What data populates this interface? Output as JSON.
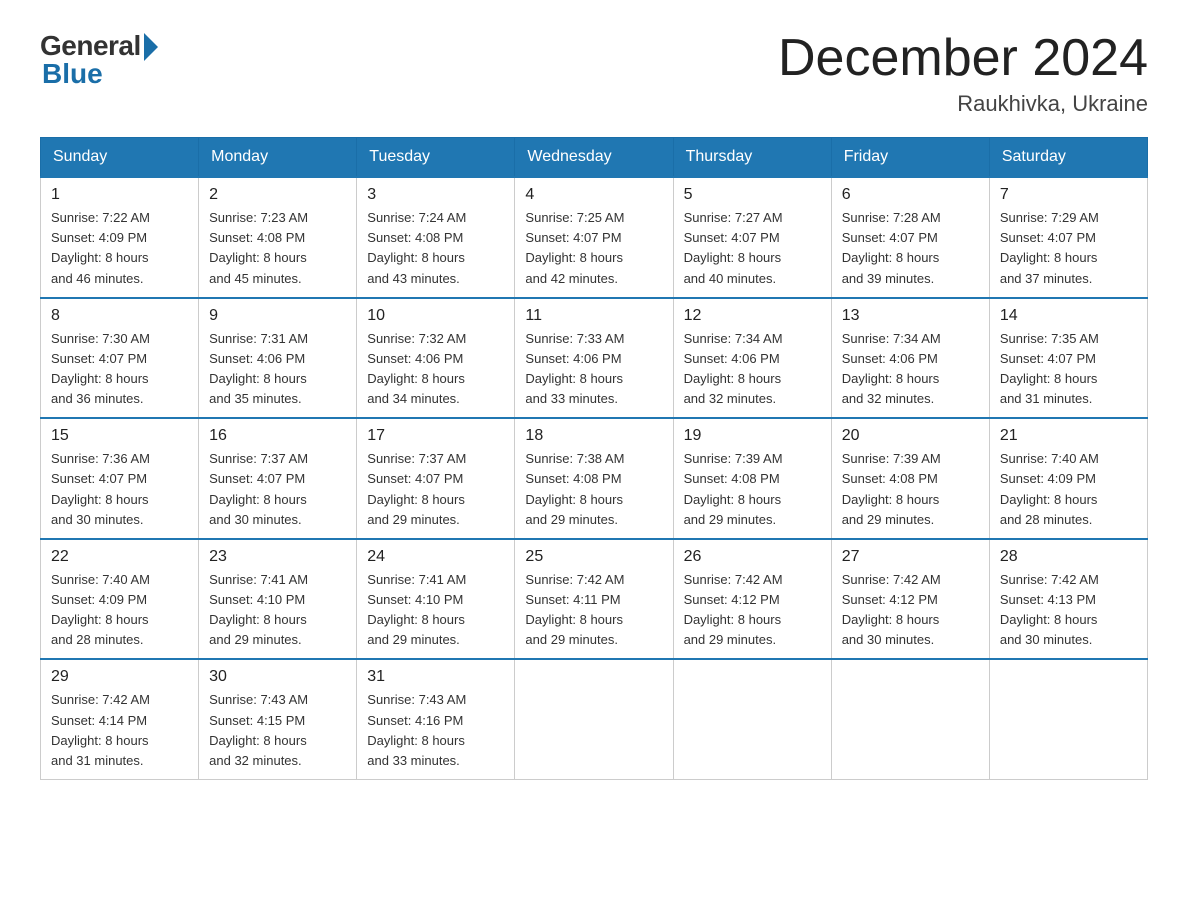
{
  "logo": {
    "general": "General",
    "blue": "Blue"
  },
  "header": {
    "month": "December 2024",
    "location": "Raukhivka, Ukraine"
  },
  "weekdays": [
    "Sunday",
    "Monday",
    "Tuesday",
    "Wednesday",
    "Thursday",
    "Friday",
    "Saturday"
  ],
  "weeks": [
    [
      {
        "day": "1",
        "sunrise": "7:22 AM",
        "sunset": "4:09 PM",
        "daylight": "8 hours and 46 minutes."
      },
      {
        "day": "2",
        "sunrise": "7:23 AM",
        "sunset": "4:08 PM",
        "daylight": "8 hours and 45 minutes."
      },
      {
        "day": "3",
        "sunrise": "7:24 AM",
        "sunset": "4:08 PM",
        "daylight": "8 hours and 43 minutes."
      },
      {
        "day": "4",
        "sunrise": "7:25 AM",
        "sunset": "4:07 PM",
        "daylight": "8 hours and 42 minutes."
      },
      {
        "day": "5",
        "sunrise": "7:27 AM",
        "sunset": "4:07 PM",
        "daylight": "8 hours and 40 minutes."
      },
      {
        "day": "6",
        "sunrise": "7:28 AM",
        "sunset": "4:07 PM",
        "daylight": "8 hours and 39 minutes."
      },
      {
        "day": "7",
        "sunrise": "7:29 AM",
        "sunset": "4:07 PM",
        "daylight": "8 hours and 37 minutes."
      }
    ],
    [
      {
        "day": "8",
        "sunrise": "7:30 AM",
        "sunset": "4:07 PM",
        "daylight": "8 hours and 36 minutes."
      },
      {
        "day": "9",
        "sunrise": "7:31 AM",
        "sunset": "4:06 PM",
        "daylight": "8 hours and 35 minutes."
      },
      {
        "day": "10",
        "sunrise": "7:32 AM",
        "sunset": "4:06 PM",
        "daylight": "8 hours and 34 minutes."
      },
      {
        "day": "11",
        "sunrise": "7:33 AM",
        "sunset": "4:06 PM",
        "daylight": "8 hours and 33 minutes."
      },
      {
        "day": "12",
        "sunrise": "7:34 AM",
        "sunset": "4:06 PM",
        "daylight": "8 hours and 32 minutes."
      },
      {
        "day": "13",
        "sunrise": "7:34 AM",
        "sunset": "4:06 PM",
        "daylight": "8 hours and 32 minutes."
      },
      {
        "day": "14",
        "sunrise": "7:35 AM",
        "sunset": "4:07 PM",
        "daylight": "8 hours and 31 minutes."
      }
    ],
    [
      {
        "day": "15",
        "sunrise": "7:36 AM",
        "sunset": "4:07 PM",
        "daylight": "8 hours and 30 minutes."
      },
      {
        "day": "16",
        "sunrise": "7:37 AM",
        "sunset": "4:07 PM",
        "daylight": "8 hours and 30 minutes."
      },
      {
        "day": "17",
        "sunrise": "7:37 AM",
        "sunset": "4:07 PM",
        "daylight": "8 hours and 29 minutes."
      },
      {
        "day": "18",
        "sunrise": "7:38 AM",
        "sunset": "4:08 PM",
        "daylight": "8 hours and 29 minutes."
      },
      {
        "day": "19",
        "sunrise": "7:39 AM",
        "sunset": "4:08 PM",
        "daylight": "8 hours and 29 minutes."
      },
      {
        "day": "20",
        "sunrise": "7:39 AM",
        "sunset": "4:08 PM",
        "daylight": "8 hours and 29 minutes."
      },
      {
        "day": "21",
        "sunrise": "7:40 AM",
        "sunset": "4:09 PM",
        "daylight": "8 hours and 28 minutes."
      }
    ],
    [
      {
        "day": "22",
        "sunrise": "7:40 AM",
        "sunset": "4:09 PM",
        "daylight": "8 hours and 28 minutes."
      },
      {
        "day": "23",
        "sunrise": "7:41 AM",
        "sunset": "4:10 PM",
        "daylight": "8 hours and 29 minutes."
      },
      {
        "day": "24",
        "sunrise": "7:41 AM",
        "sunset": "4:10 PM",
        "daylight": "8 hours and 29 minutes."
      },
      {
        "day": "25",
        "sunrise": "7:42 AM",
        "sunset": "4:11 PM",
        "daylight": "8 hours and 29 minutes."
      },
      {
        "day": "26",
        "sunrise": "7:42 AM",
        "sunset": "4:12 PM",
        "daylight": "8 hours and 29 minutes."
      },
      {
        "day": "27",
        "sunrise": "7:42 AM",
        "sunset": "4:12 PM",
        "daylight": "8 hours and 30 minutes."
      },
      {
        "day": "28",
        "sunrise": "7:42 AM",
        "sunset": "4:13 PM",
        "daylight": "8 hours and 30 minutes."
      }
    ],
    [
      {
        "day": "29",
        "sunrise": "7:42 AM",
        "sunset": "4:14 PM",
        "daylight": "8 hours and 31 minutes."
      },
      {
        "day": "30",
        "sunrise": "7:43 AM",
        "sunset": "4:15 PM",
        "daylight": "8 hours and 32 minutes."
      },
      {
        "day": "31",
        "sunrise": "7:43 AM",
        "sunset": "4:16 PM",
        "daylight": "8 hours and 33 minutes."
      },
      null,
      null,
      null,
      null
    ]
  ],
  "labels": {
    "sunrise": "Sunrise:",
    "sunset": "Sunset:",
    "daylight": "Daylight:"
  }
}
